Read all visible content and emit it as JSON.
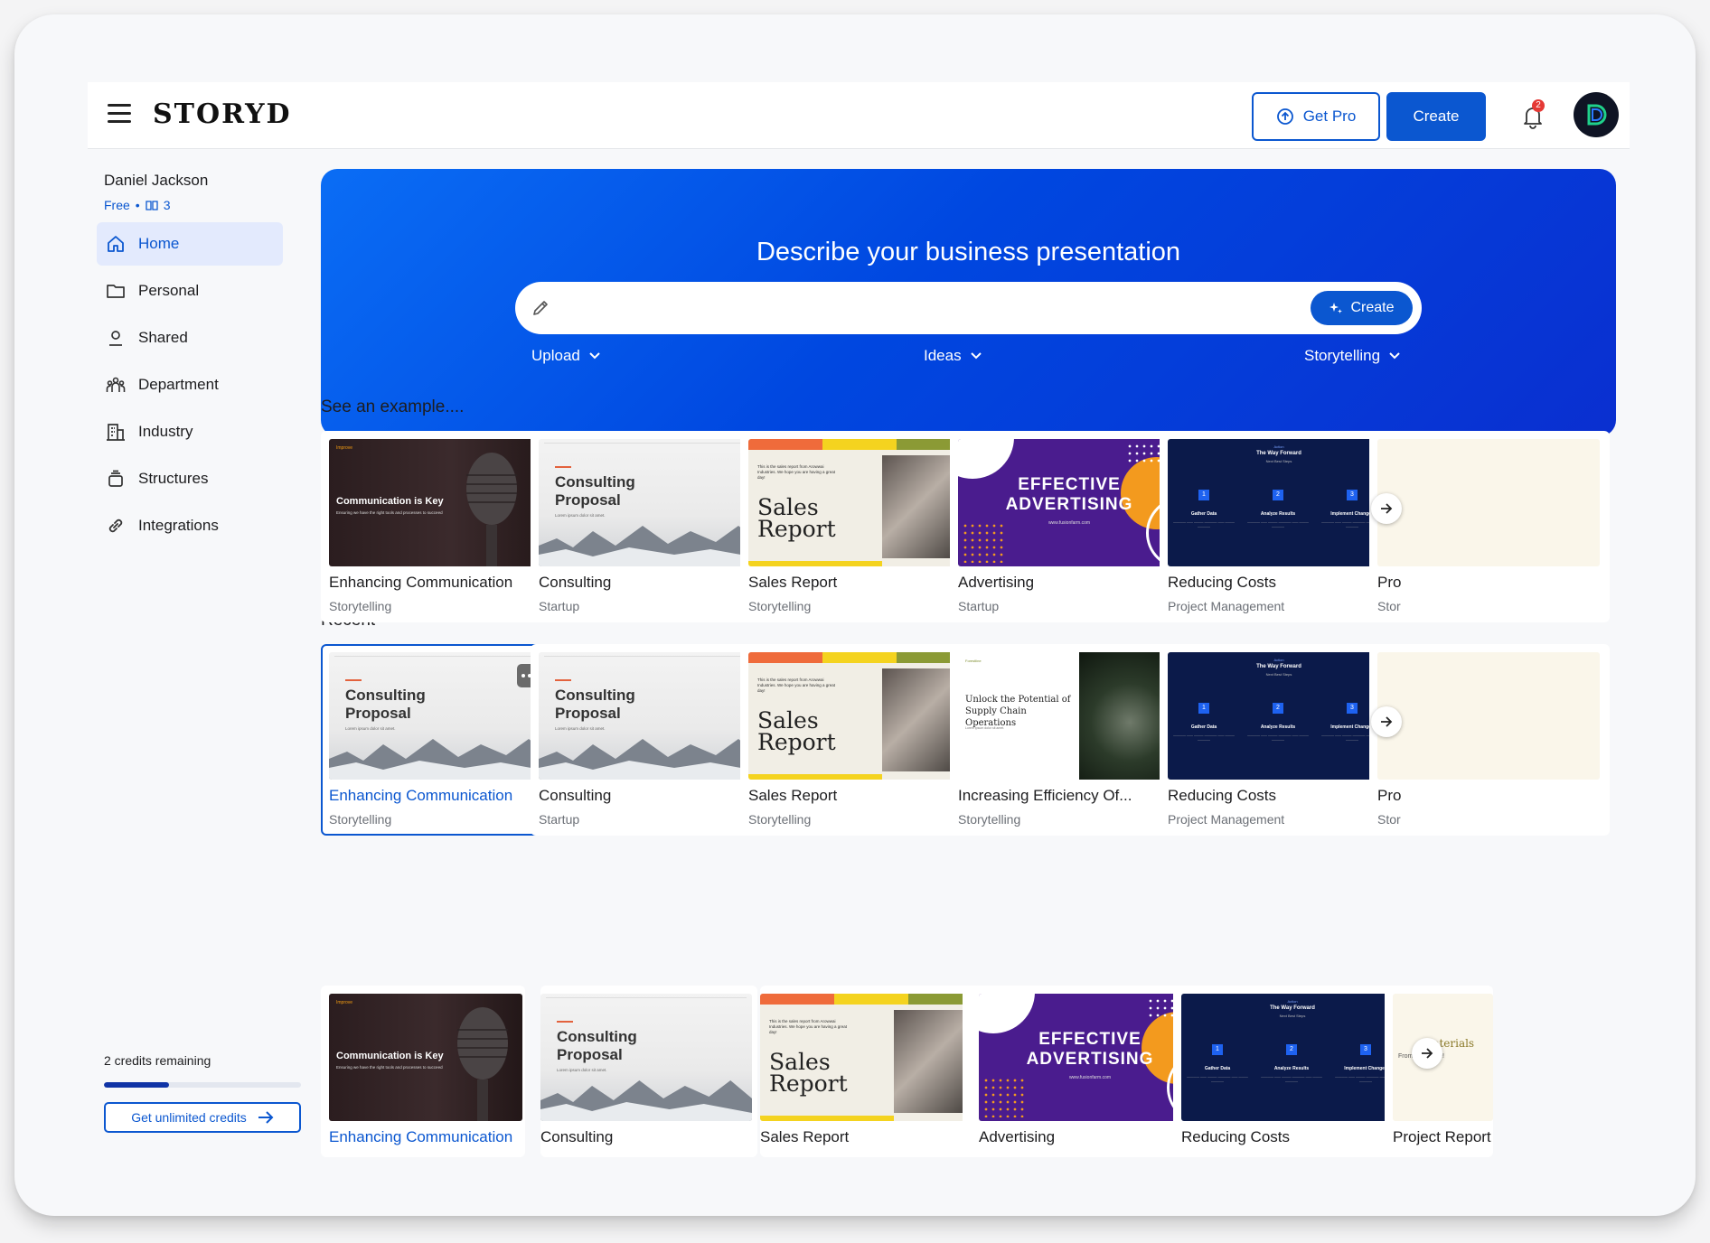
{
  "topbar": {
    "logo": "STORYD",
    "get_pro_label": "Get Pro",
    "create_label": "Create",
    "notification_count": "2",
    "avatar_letter": "D"
  },
  "user": {
    "name": "Daniel Jackson",
    "plan": "Free",
    "separator": "•",
    "book_count": "3"
  },
  "sidebar": {
    "items": [
      {
        "label": "Home",
        "icon": "home-icon"
      },
      {
        "label": "Personal",
        "icon": "folder-icon"
      },
      {
        "label": "Shared",
        "icon": "person-icon"
      },
      {
        "label": "Department",
        "icon": "people-icon"
      },
      {
        "label": "Industry",
        "icon": "building-icon"
      },
      {
        "label": "Structures",
        "icon": "stack-icon"
      },
      {
        "label": "Integrations",
        "icon": "link-icon"
      }
    ],
    "credits_text": "2 credits remaining",
    "credits_fraction": 0.33,
    "unlimited_label": "Get unlimited credits"
  },
  "hero": {
    "title": "Describe your business presentation",
    "input_value": "",
    "create_label": "Create",
    "upload_label": "Upload",
    "ideas_label": "Ideas",
    "storytelling_label": "Storytelling"
  },
  "sections": {
    "examples_title": "See an example....",
    "recent_title": "Recent"
  },
  "thumbs": {
    "comm_brand": "Improve",
    "comm_head": "Communication is Key",
    "comm_sub": "Ensuring we have the right tools and processes to succeed",
    "cons_head1": "Consulting",
    "cons_head2": "Proposal",
    "cons_sub": "Lorem ipsum dolor sit amet.",
    "sales_head1": "Sales",
    "sales_head2": "Report",
    "sales_txt": "This is the sales report from Arowwai Industries. We hope you are having a great day!",
    "adv_head1": "EFFECTIVE",
    "adv_head2": "ADVERTISING",
    "adv_url": "www.fusionfarm.com",
    "red_k": "Action",
    "red_head": "The Way Forward",
    "red_sub": "Next Best Steps",
    "red_steps": [
      "Gather Data",
      "Analyze Results",
      "Implement Changes"
    ],
    "supply_k": "Forestline",
    "supply_head": "Unlock the Potential of Supply Chain Operations",
    "supply_sub": "Lorem ipsum dolor sit amet.",
    "proj_head": "Materials",
    "proj_sub": "From the house!"
  },
  "examples": [
    {
      "title": "Enhancing Communication",
      "sub": "Storytelling"
    },
    {
      "title": "Consulting",
      "sub": "Startup"
    },
    {
      "title": "Sales Report",
      "sub": "Storytelling"
    },
    {
      "title": "Advertising",
      "sub": "Startup"
    },
    {
      "title": "Reducing Costs",
      "sub": "Project Management"
    },
    {
      "title": "Pro",
      "sub": "Stor"
    }
  ],
  "recent": [
    {
      "title": "Enhancing Communication",
      "sub": "Storytelling"
    },
    {
      "title": "Consulting",
      "sub": "Startup"
    },
    {
      "title": "Sales Report",
      "sub": "Storytelling"
    },
    {
      "title": "Increasing Efficiency Of...",
      "sub": "Storytelling"
    },
    {
      "title": "Reducing Costs",
      "sub": "Project Management"
    },
    {
      "title": "Pro",
      "sub": "Stor"
    }
  ],
  "more": [
    {
      "title": "Enhancing Communication"
    },
    {
      "title": "Consulting"
    },
    {
      "title": "Sales Report"
    },
    {
      "title": "Advertising"
    },
    {
      "title": "Reducing Costs"
    },
    {
      "title": "Project Report"
    }
  ]
}
